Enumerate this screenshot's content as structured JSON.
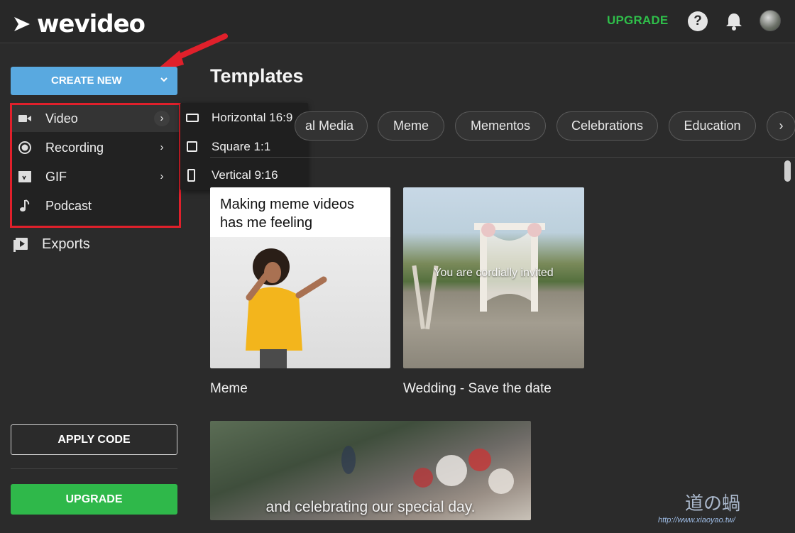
{
  "header": {
    "brand": "wevideo",
    "upgrade_link": "UPGRADE",
    "help_glyph": "?",
    "icons": [
      "help-icon",
      "bell-icon",
      "avatar"
    ]
  },
  "sidebar": {
    "create_new": "CREATE NEW",
    "menu": [
      {
        "label": "Video",
        "icon": "video-camera-icon",
        "has_submenu": true
      },
      {
        "label": "Recording",
        "icon": "record-icon",
        "has_submenu": true
      },
      {
        "label": "GIF",
        "icon": "gif-icon",
        "has_submenu": true
      },
      {
        "label": "Podcast",
        "icon": "music-note-icon",
        "has_submenu": false
      }
    ],
    "submenu": [
      {
        "label": "Horizontal 16:9",
        "icon": "horizontal-frame-icon"
      },
      {
        "label": "Square 1:1",
        "icon": "square-frame-icon"
      },
      {
        "label": "Vertical 9:16",
        "icon": "vertical-frame-icon"
      }
    ],
    "exports": "Exports",
    "apply_code": "APPLY CODE",
    "upgrade": "UPGRADE"
  },
  "main": {
    "title": "Templates",
    "chips": [
      "al Media",
      "Meme",
      "Mementos",
      "Celebrations",
      "Education"
    ],
    "chip_next": "›",
    "cards": [
      {
        "title": "Meme",
        "overlay_text": "Making meme videos has me feeling"
      },
      {
        "title": "Wedding - Save the date",
        "overlay_text": "You are cordially invited"
      },
      {
        "title": "",
        "overlay_text": "and celebrating our special day."
      }
    ]
  },
  "watermark": {
    "text": "道の蝸",
    "url": "http://www.xiaoyao.tw/"
  },
  "colors": {
    "accent_blue": "#59a9e0",
    "upgrade_green": "#2fb84a",
    "highlight_red": "#e0202b"
  }
}
